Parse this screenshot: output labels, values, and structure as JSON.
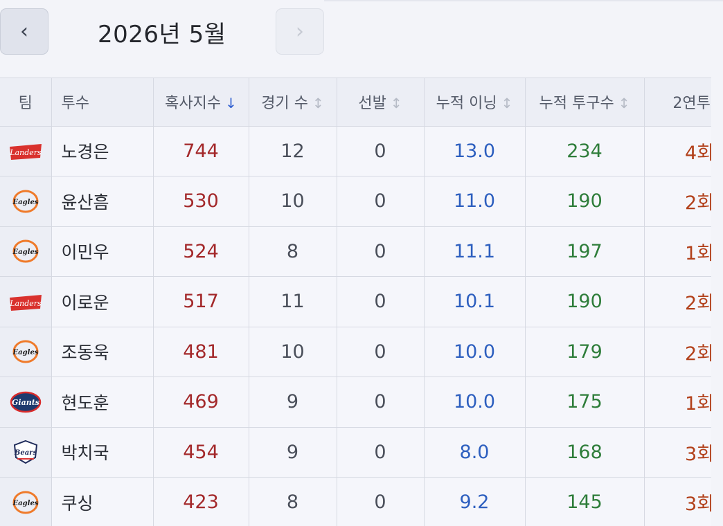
{
  "header": {
    "month_title": "2026년 5월",
    "prev_label": "‹",
    "next_label": "›"
  },
  "table": {
    "columns": {
      "team": "팀",
      "pitcher": "투수",
      "strikes": "혹사지수",
      "games": "경기 수",
      "starts": "선발",
      "innings": "누적 이닝",
      "pitches": "누적 투구수",
      "consecutive": "2연투"
    },
    "sort_arrow_active": "↓",
    "sort_arrow": "↕",
    "rows": [
      {
        "team_icon": "landers-logo",
        "team_text": "Landers",
        "name": "노경은",
        "index": "744",
        "games": "12",
        "starts": "0",
        "innings": "13.0",
        "pitches": "234",
        "consecutive": "4회"
      },
      {
        "team_icon": "eagles-logo",
        "team_text": "Eagles",
        "name": "윤산흠",
        "index": "530",
        "games": "10",
        "starts": "0",
        "innings": "11.0",
        "pitches": "190",
        "consecutive": "2회"
      },
      {
        "team_icon": "eagles-logo",
        "team_text": "Eagles",
        "name": "이민우",
        "index": "524",
        "games": "8",
        "starts": "0",
        "innings": "11.1",
        "pitches": "197",
        "consecutive": "1회"
      },
      {
        "team_icon": "landers-logo",
        "team_text": "Landers",
        "name": "이로운",
        "index": "517",
        "games": "11",
        "starts": "0",
        "innings": "10.1",
        "pitches": "190",
        "consecutive": "2회"
      },
      {
        "team_icon": "eagles-logo",
        "team_text": "Eagles",
        "name": "조동욱",
        "index": "481",
        "games": "10",
        "starts": "0",
        "innings": "10.0",
        "pitches": "179",
        "consecutive": "2회"
      },
      {
        "team_icon": "giants-logo",
        "team_text": "Giants",
        "name": "현도훈",
        "index": "469",
        "games": "9",
        "starts": "0",
        "innings": "10.0",
        "pitches": "175",
        "consecutive": "1회"
      },
      {
        "team_icon": "bears-logo",
        "team_text": "Bears",
        "name": "박치국",
        "index": "454",
        "games": "9",
        "starts": "0",
        "innings": "8.0",
        "pitches": "168",
        "consecutive": "3회"
      },
      {
        "team_icon": "eagles-logo",
        "team_text": "Eagles",
        "name": "쿠싱",
        "index": "423",
        "games": "8",
        "starts": "0",
        "innings": "9.2",
        "pitches": "145",
        "consecutive": "3회"
      }
    ]
  },
  "colors": {
    "index": "#a3282a",
    "innings": "#2d5fbf",
    "pitches": "#2e7d3a",
    "consecutive": "#b2401a"
  }
}
